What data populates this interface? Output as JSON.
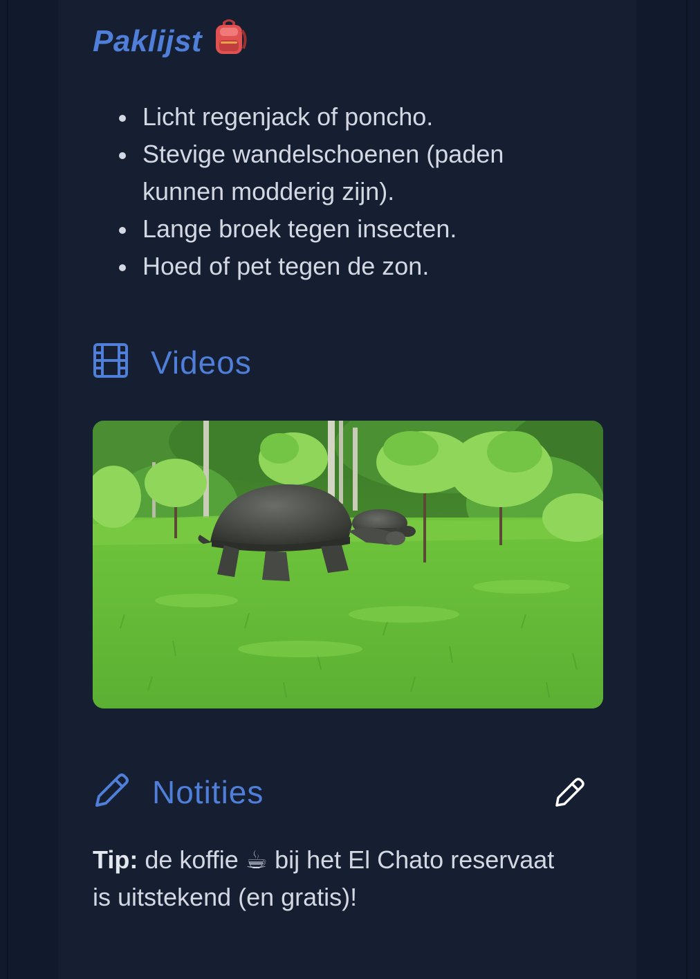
{
  "paklijst": {
    "title": "Paklijst",
    "title_icon": "backpack-icon",
    "items": [
      "Licht regenjack of poncho.",
      "Stevige wandelschoenen (paden kunnen modderig zijn).",
      "Lange broek tegen insecten.",
      "Hoed of pet tegen de zon."
    ]
  },
  "videos": {
    "title": "Videos",
    "icon": "film-icon",
    "thumbnail": "giant-tortoise-video-thumbnail"
  },
  "notities": {
    "title": "Notities",
    "icon": "pencil-icon",
    "edit_icon": "edit-pencil-icon",
    "tip_label": "Tip:",
    "tip_text_before": " de koffie ",
    "tip_emoji": "☕",
    "tip_text_after": " bij het El Chato reservaat is uitstekend (en gratis)!"
  },
  "colors": {
    "accent": "#4f7fd9",
    "background": "#111a2c",
    "panel": "#161f32",
    "text": "#d3d8e2"
  }
}
